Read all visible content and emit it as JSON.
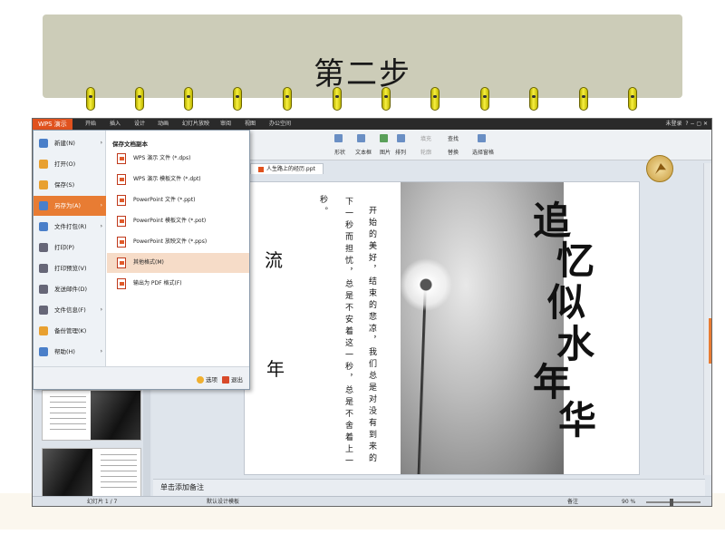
{
  "banner": {
    "title": "第二步"
  },
  "app": {
    "badge": "WPS 演示",
    "menu_tabs": [
      "开始",
      "插入",
      "设计",
      "动画",
      "幻灯片放映",
      "审阅",
      "视图",
      "办公空间"
    ],
    "account": "未登录",
    "ribbon": {
      "shape": "形状",
      "textbox": "文本框",
      "picture": "图片",
      "arrange": "排列",
      "find": "查找",
      "replace": "替换",
      "select_pane": "选择窗格",
      "fill": "填充",
      "outline": "轮廓"
    },
    "file_menu": {
      "items": [
        {
          "label": "新建(N)",
          "arrow": true,
          "color": "#4a7fc9"
        },
        {
          "label": "打开(O)",
          "arrow": false,
          "color": "#e8a030"
        },
        {
          "label": "保存(S)",
          "arrow": false,
          "color": "#e8a030"
        },
        {
          "label": "另存为(A)",
          "arrow": true,
          "color": "#4a7fc9"
        },
        {
          "label": "文件打包(R)",
          "arrow": true,
          "color": "#4a7fc9"
        },
        {
          "label": "打印(P)",
          "arrow": false,
          "color": "#667"
        },
        {
          "label": "打印预览(V)",
          "arrow": false,
          "color": "#667"
        },
        {
          "label": "发送邮件(D)",
          "arrow": false,
          "color": "#667"
        },
        {
          "label": "文件信息(F)",
          "arrow": true,
          "color": "#667"
        },
        {
          "label": "备份管理(K)",
          "arrow": false,
          "color": "#e8a030"
        },
        {
          "label": "帮助(H)",
          "arrow": true,
          "color": "#4a7fc9"
        }
      ],
      "active_index": 3,
      "submenu_title": "保存文档副本",
      "submenu_items": [
        "WPS 演示 文件 (*.dps)",
        "WPS 演示 模板文件 (*.dpt)",
        "PowerPoint 文件 (*.ppt)",
        "PowerPoint 模板文件 (*.pot)",
        "PowerPoint 放映文件 (*.pps)",
        "其他格式(M)",
        "输出为 PDF 格式(F)"
      ],
      "highlight_index": 5,
      "options": "选项",
      "exit": "退出"
    },
    "doc_tab": "人生路上的经历.ppt",
    "notes_placeholder": "单击添加备注",
    "status": {
      "slide_info": "幻灯片 1 / 7",
      "template": "默认设计模板",
      "notes_btn": "备注",
      "zoom": "90 %"
    },
    "slide": {
      "title_chars": [
        "追",
        "忆",
        "似",
        "水",
        "年",
        "华"
      ],
      "side_chars": [
        "流",
        "年"
      ],
      "col_1": "开始的美好，结束的悲凉，我们总是对没有到来的",
      "col_2": "下一秒而担忧，总是不安着这一秒，总是不舍着上一",
      "col_3": "秒。"
    }
  }
}
